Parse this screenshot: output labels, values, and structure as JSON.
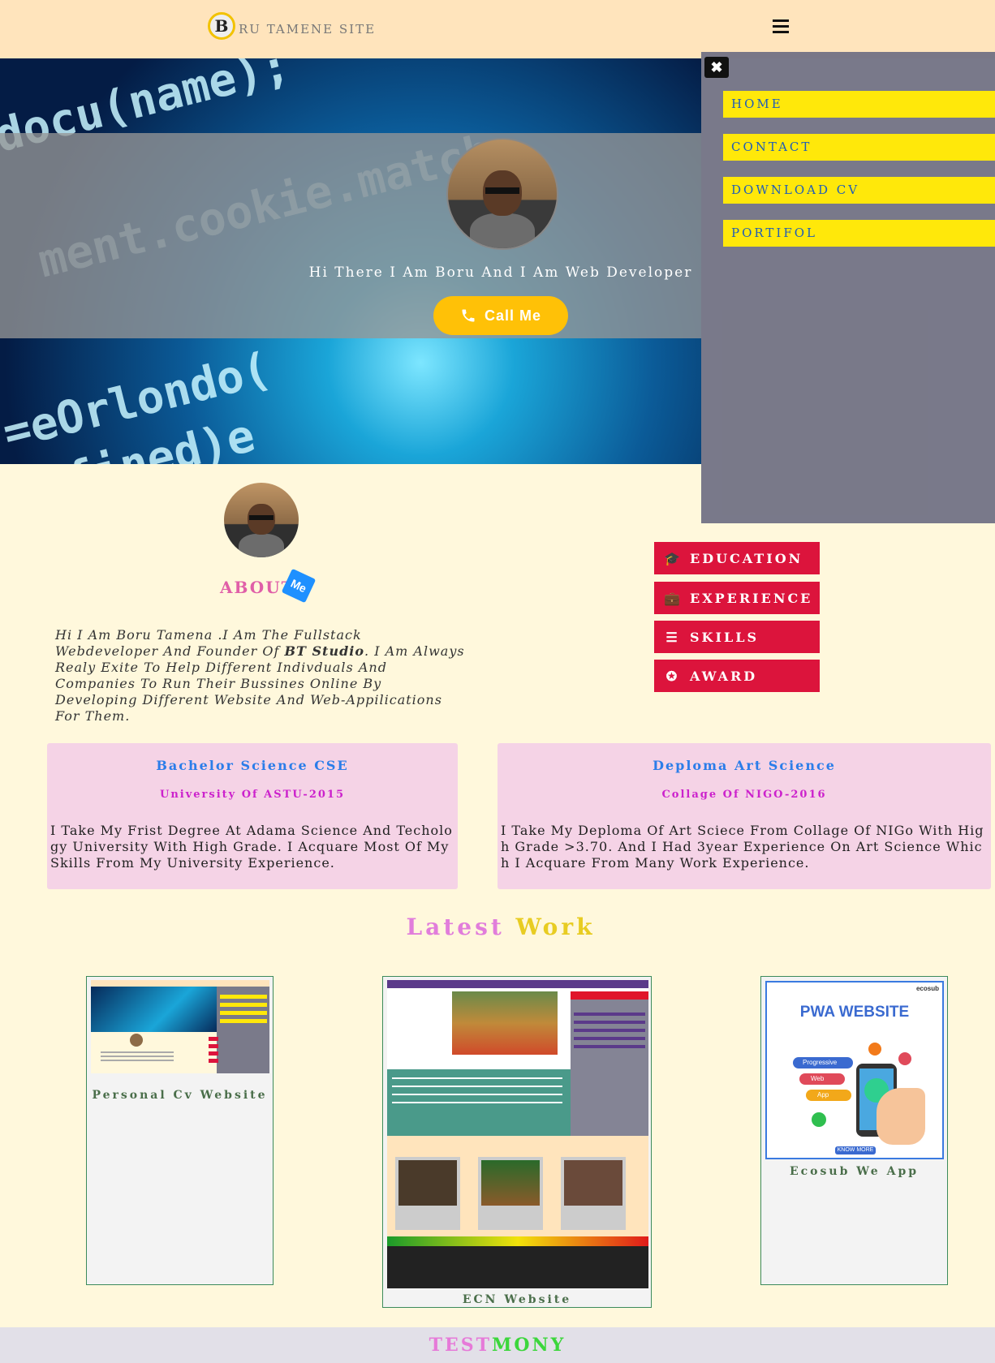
{
  "header": {
    "logo_letter": "B",
    "logo_text": "RU TAMENE SITE",
    "menu_icon": "hamburger-icon"
  },
  "hero": {
    "greeting": "Hi There I Am Boru And I Am Web Developer",
    "call_button": "Call Me",
    "call_icon": "phone-icon"
  },
  "sidenav": {
    "close_icon": "close-icon",
    "items": [
      {
        "label": "HOME"
      },
      {
        "label": "CONTACT"
      },
      {
        "label": "DOWNLOAD CV"
      },
      {
        "label": "PORTIFOL"
      }
    ]
  },
  "about": {
    "title": "ABOUT",
    "badge": "Me",
    "text_part1": "Hi I Am Boru Tamena .I Am The Fullstack Webdeveloper And Founder Of ",
    "text_bold": "BT Studio",
    "text_part2": ". I Am Always Realy Exite To Help Different Indivduals And Companies To Run Their Bussines Online By Developing Different Website And Web-Appilications For Them."
  },
  "tabs": [
    {
      "label": "EDUCATION",
      "icon": "graduation-cap-icon"
    },
    {
      "label": "EXPERIENCE",
      "icon": "briefcase-icon"
    },
    {
      "label": "SKILLS",
      "icon": "list-icon"
    },
    {
      "label": "AWARD",
      "icon": "award-icon"
    }
  ],
  "education": [
    {
      "title": "Bachelor Science CSE",
      "subtitle": "University Of ASTU-2015",
      "text": "I Take My Frist Degree At Adama Science And Techology University With High Grade. I Acquare Most Of My Skills From My University Experience."
    },
    {
      "title": "Deploma Art Science",
      "subtitle": "Collage Of NIGO-2016",
      "text": "I Take My Deploma Of Art Sciece From Collage Of NIGo With High Grade >3.70. And I Had 3year Experience On Art Science Which I Acquare From Many Work Experience."
    }
  ],
  "latest_work": {
    "title_a": "Latest",
    "title_b": "Work",
    "items": [
      {
        "label": "Personal Cv Website"
      },
      {
        "label": "ECN Website"
      },
      {
        "label": "Ecosub We App",
        "thumb_title": "PWA WEBSITE",
        "thumb_tags": [
          "Progressive",
          "Web",
          "App"
        ],
        "thumb_button": "KNOW MORE",
        "thumb_brand": "ecosub"
      }
    ]
  },
  "testimony": {
    "part_a": "TEST",
    "part_b": "MONY"
  },
  "colors": {
    "topbar": "#ffe4bc",
    "page": "#fff8dc",
    "nav_item": "#ffe80a",
    "tab": "#dc143c",
    "call": "#ffc107",
    "card": "#f5d3e6"
  }
}
